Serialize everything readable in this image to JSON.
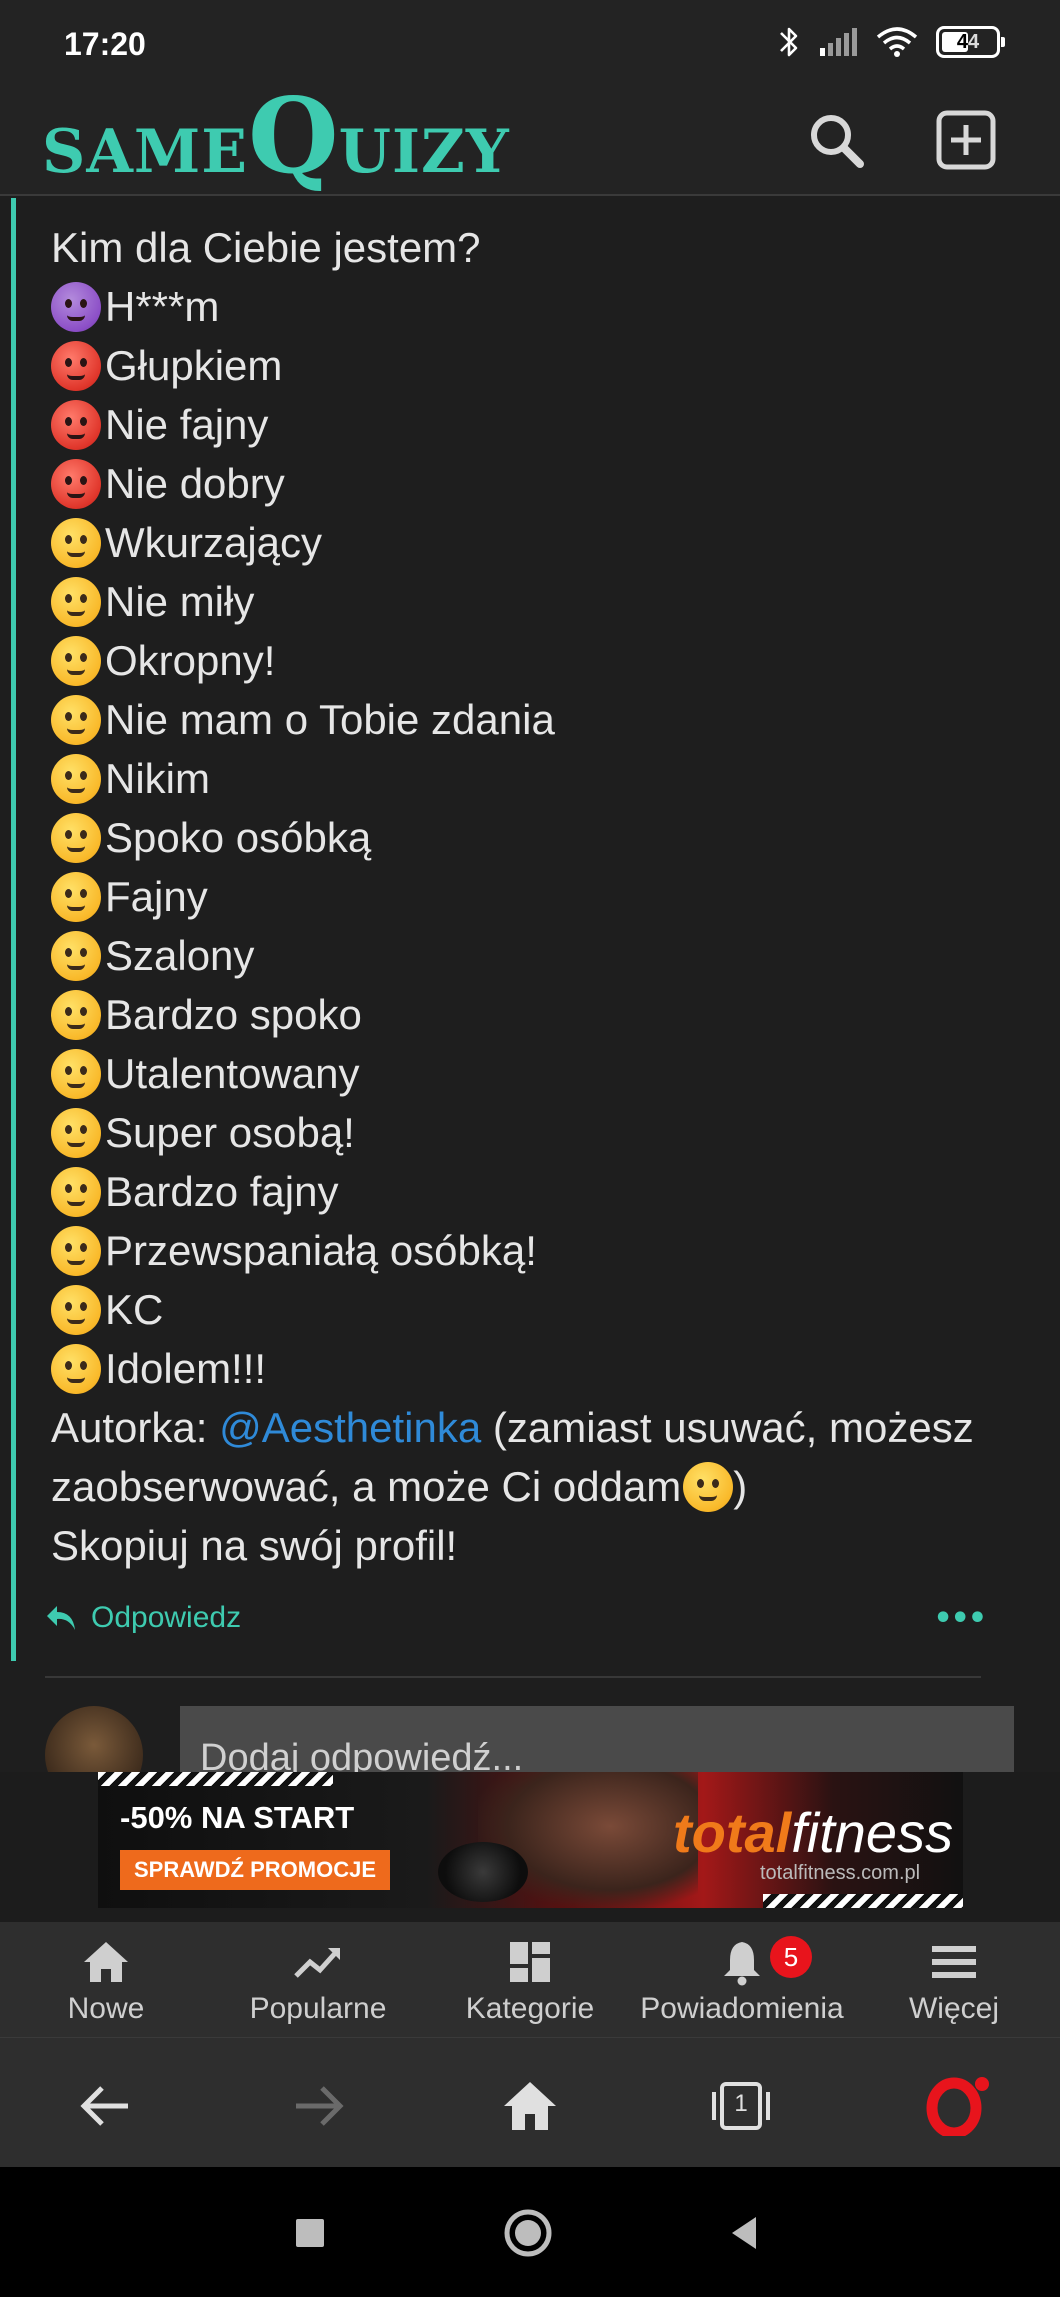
{
  "status_bar": {
    "time": "17:20",
    "battery": "44",
    "icons": [
      "bluetooth-icon",
      "signal-icon",
      "wifi-icon",
      "battery-icon"
    ]
  },
  "header": {
    "logo_same": "same",
    "logo_q": "Q",
    "logo_uizy": "uizy",
    "brand_color": "#3ecbb0",
    "icons": [
      "search-icon",
      "plus-square-icon"
    ]
  },
  "comment": {
    "lines": [
      {
        "emoji": "none",
        "text": "Kim dla Ciebie jestem?"
      },
      {
        "emoji": "smiling-devil",
        "text": "H***m"
      },
      {
        "emoji": "cursing-face",
        "text": "Głupkiem"
      },
      {
        "emoji": "angry-face",
        "text": "Nie fajny"
      },
      {
        "emoji": "pouting-face",
        "text": "Nie dobry"
      },
      {
        "emoji": "steam-nose-face",
        "text": "Wkurzający"
      },
      {
        "emoji": "weary-face",
        "text": "Nie miły"
      },
      {
        "emoji": "crying-face",
        "text": "Okropny!"
      },
      {
        "emoji": "flushed-face",
        "text": "Nie mam o Tobie zdania"
      },
      {
        "emoji": "expressionless-face",
        "text": "Nikim"
      },
      {
        "emoji": "kissing-face",
        "text": "Spoko osóbką"
      },
      {
        "emoji": "kissing-smiling-eyes",
        "text": "Fajny"
      },
      {
        "emoji": "zany-face",
        "text": "Szalony"
      },
      {
        "emoji": "squinting-tongue-face",
        "text": "Bardzo spoko"
      },
      {
        "emoji": "face-blowing-kiss",
        "text": "Utalentowany"
      },
      {
        "emoji": "smiling-face",
        "text": "Super osobą!"
      },
      {
        "emoji": "winking-face",
        "text": "Bardzo fajny"
      },
      {
        "emoji": "smiling-hearts-face",
        "text": "Przewspaniałą osóbką!"
      },
      {
        "emoji": "heart-eyes-face",
        "text": "KC"
      },
      {
        "emoji": "star-struck-face",
        "text": "Idolem!!!"
      }
    ],
    "author_prefix": "Autorka: ",
    "author_mention": "@Aesthetinka",
    "author_suffix": " (zamiast usuwać, możesz",
    "author_line2": "zaobserwować, a może Ci oddam",
    "author_line2_end": ")",
    "footer_line": "Skopiuj na swój profil!",
    "reply_label": "Odpowiedz",
    "more_label": "•••"
  },
  "reply_box": {
    "placeholder": "Dodaj odpowiedź..."
  },
  "ad": {
    "headline": "-50% NA START",
    "cta": "SPRAWDŹ PROMOCJE",
    "brand_total": "total",
    "brand_fitness": "fitness",
    "url": "totalfitness.com.pl"
  },
  "bottom_nav": {
    "items": [
      {
        "label": "Nowe",
        "icon": "home-icon"
      },
      {
        "label": "Popularne",
        "icon": "trending-icon"
      },
      {
        "label": "Kategorie",
        "icon": "dashboard-icon"
      },
      {
        "label": "Powiadomienia",
        "icon": "bell-icon",
        "badge": "5"
      },
      {
        "label": "Więcej",
        "icon": "menu-icon"
      }
    ]
  },
  "browser_bar": {
    "tab_count": "1",
    "icons": [
      "back-arrow-icon",
      "forward-arrow-icon",
      "home-icon",
      "tabs-icon",
      "opera-icon"
    ]
  }
}
